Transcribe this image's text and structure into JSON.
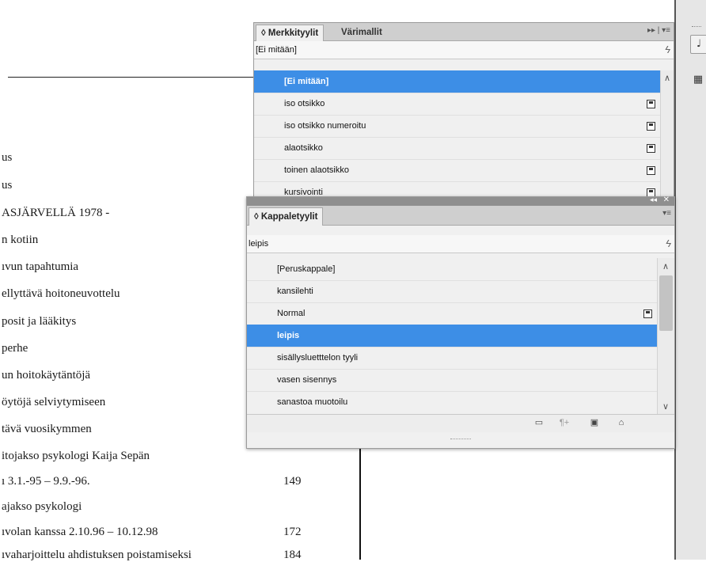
{
  "document": {
    "toc_lines": [
      {
        "text": "us",
        "page": ""
      },
      {
        "text": "us",
        "page": ""
      },
      {
        "text": "ASJÄRVELLÄ 1978 -",
        "page": ""
      },
      {
        "text": "n kotiin",
        "page": ""
      },
      {
        "text": "ıvun tapahtumia",
        "page": ""
      },
      {
        "text": "ellyttävä hoitoneuvottelu",
        "page": ""
      },
      {
        "text": "posit ja lääkitys",
        "page": ""
      },
      {
        "text": "perhe",
        "page": ""
      },
      {
        "text": "un hoitokäytäntöjä",
        "page": ""
      },
      {
        "text": "öytöjä selviytymiseen",
        "page": ""
      },
      {
        "text": "tävä vuosikymmen",
        "page": ""
      },
      {
        "text": "itojakso psykologi Kaija Sepän",
        "page": ""
      },
      {
        "text": "ı 3.1.-95 – 9.9.-96.",
        "page": "149"
      },
      {
        "text": "ajakso psykologi",
        "page": ""
      },
      {
        "text": "ıvolan kanssa 2.10.96 – 10.12.98",
        "page": "172"
      },
      {
        "text": "ıvaharjoittelu ahdistuksen poistamiseksi",
        "page": "184"
      }
    ]
  },
  "character_styles_panel": {
    "tabs": [
      {
        "label": "◊ Merkkityylit",
        "active": true
      },
      {
        "label": "Värimallit",
        "active": false
      }
    ],
    "tab_tools": "▸▸ | ▾≡",
    "filter_text": "[Ei mitään]",
    "lightning_icon": "lightning-icon",
    "items": [
      {
        "label": "[Ei mitään]",
        "selected": true,
        "saved": false
      },
      {
        "label": "iso otsikko",
        "selected": false,
        "saved": true
      },
      {
        "label": "iso otsikko numeroitu",
        "selected": false,
        "saved": true
      },
      {
        "label": "alaotsikko",
        "selected": false,
        "saved": true
      },
      {
        "label": "toinen alaotsikko",
        "selected": false,
        "saved": true
      },
      {
        "label": "kursivointi",
        "selected": false,
        "saved": true
      }
    ]
  },
  "paragraph_styles_panel": {
    "floatbar_collapse": "◂◂",
    "floatbar_close": "✕",
    "tab_label": "◊ Kappaletyylit",
    "tab_menu": "▾≡",
    "filter_text": "leipis",
    "items": [
      {
        "label": "[Peruskappale]",
        "selected": false,
        "saved": false
      },
      {
        "label": "kansilehti",
        "selected": false,
        "saved": false
      },
      {
        "label": "Normal",
        "selected": false,
        "saved": true
      },
      {
        "label": "leipis",
        "selected": true,
        "saved": false
      },
      {
        "label": "sisällysluetttelon tyyli",
        "selected": false,
        "saved": false
      },
      {
        "label": "vasen sisennys",
        "selected": false,
        "saved": false
      },
      {
        "label": "sanastoa muotoilu",
        "selected": false,
        "saved": false
      }
    ],
    "footer_icons": [
      "folder-icon",
      "clear-overrides-icon",
      "new-style-icon",
      "trash-icon"
    ]
  },
  "colors": {
    "selection": "#3d8ee6",
    "panel_bg": "#f0f0f0"
  }
}
